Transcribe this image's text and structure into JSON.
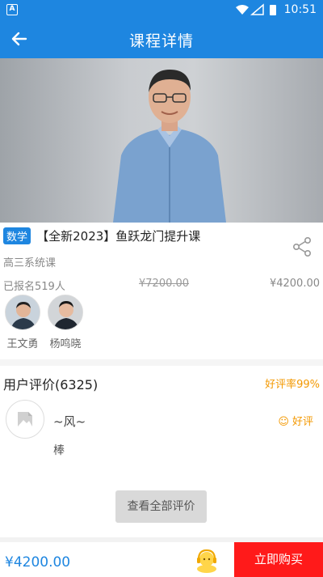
{
  "statusbar": {
    "app_badge": "A",
    "time": "10:51"
  },
  "navbar": {
    "title": "课程详情"
  },
  "course": {
    "subject_tag": "数学",
    "title": "【全新2023】鱼跃龙门提升课",
    "subtitle": "高三系统课",
    "enrolled": "已报名519人",
    "original_price": "¥7200.00",
    "price": "¥4200.00"
  },
  "teachers": [
    {
      "name": "王文勇"
    },
    {
      "name": "杨鸣晓"
    }
  ],
  "reviews": {
    "title": "用户评价(6325)",
    "good_rate": "好评率99%",
    "items": [
      {
        "user": "~风~",
        "rating_label": "☺ 好评",
        "text": "棒"
      }
    ],
    "view_all_label": "查看全部评价"
  },
  "bottom": {
    "price": "¥4200.00",
    "buy_label": "立即购买"
  },
  "colors": {
    "accent": "#1e86e0",
    "buy": "#ff1a1a",
    "good": "#f39800"
  }
}
